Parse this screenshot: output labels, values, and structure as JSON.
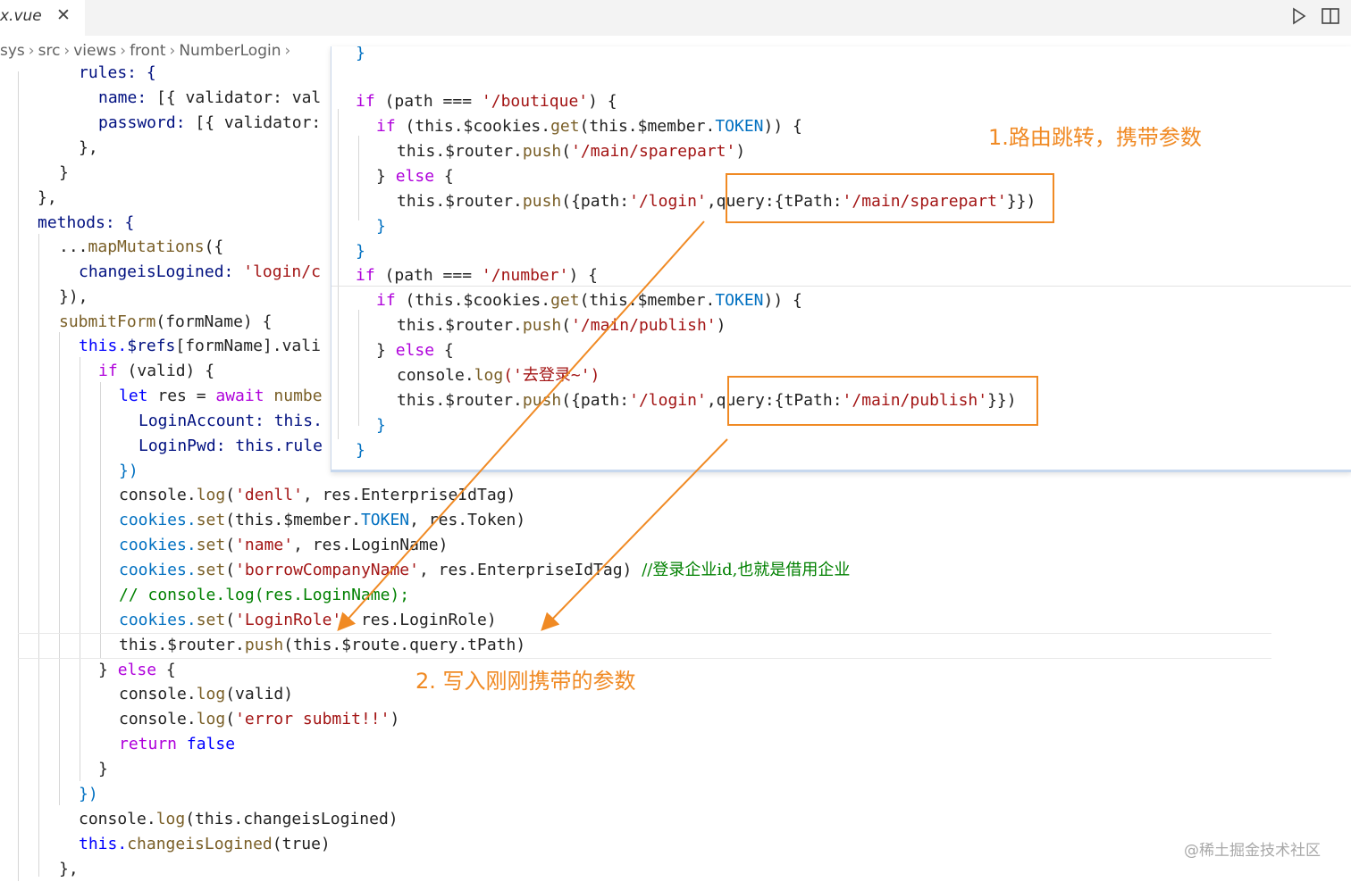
{
  "tab": {
    "filename": "x.vue",
    "close_glyph": "✕"
  },
  "toolbar": {
    "run_icon": "play-icon",
    "split_icon": "split-editor-icon"
  },
  "breadcrumb": [
    "sys",
    "src",
    "views",
    "front",
    "NumberLogin"
  ],
  "editor": {
    "rules_open": "rules: {",
    "name_key": "name:",
    "name_val": " [{ validator: val",
    "password_key": "password:",
    "password_val": " [{ validator:",
    "close_1": "},",
    "close_2": "}",
    "close_3": "},",
    "methods": "methods: {",
    "map_spread": "...",
    "map_fn": "mapMutations",
    "map_paren": "({",
    "changeis_key": "changeisLogined:",
    "changeis_val": " 'login/c",
    "map_close": "}),",
    "submit_fn": "submitForm",
    "submit_rest": "(formName) {",
    "this_refs": "this.",
    "refs_prop": "$refs",
    "refs_rest": "[formName].vali",
    "if_kw": "if",
    "if_rest": " (valid) {",
    "let_kw": "let",
    "res_mid": " res = ",
    "await_kw": "await",
    "numbe": " numbe",
    "login_acc": "LoginAccount: this.",
    "login_pwd": "LoginPwd: this.rule",
    "close_paren": "})",
    "log1_a": "console.",
    "log1_fn": "log",
    "log1_str": "'denll'",
    "log1_rest": ", res.EnterpriseIdTag)",
    "set1_a": "cookies.",
    "set_fn": "set",
    "set1_b": "(this.$member.",
    "set1_token": "TOKEN",
    "set1_rest": ", res.Token)",
    "set2_str": "'name'",
    "set2_rest": ", res.LoginName)",
    "set3_str": "'borrowCompanyName'",
    "set3_rest": ", res.EnterpriseIdTag) ",
    "set3_comment": "//登录企业id,也就是借用企业",
    "comment_line": "// console.log(res.LoginName);",
    "set4_str": "'LoginRole'",
    "set4_rest": ", res.LoginRole)",
    "push_line_a": "this.$router.",
    "push_fn": "push",
    "push_line_b": "(this.$route.query.tPath)",
    "else_close": "} ",
    "else_kw": "else",
    "else_open": " {",
    "log_valid": "(valid)",
    "log_err_str": "'error submit!!'",
    "return_kw": "return",
    "false_kw": " false",
    "brace_close": "}",
    "paren_close": "})",
    "log_changeis": "(this.changeisLogined)",
    "changeis_call_a": "this.",
    "changeis_call_fn": "changeisLogined",
    "changeis_call_b": "(true)",
    "final_close": "},"
  },
  "peek": {
    "top_brace": "}",
    "if_kw": "if",
    "cond1": " (path === ",
    "path1": "'/boutique'",
    "cond_end": ") {",
    "if_inner": "if",
    "cookie_a": " (this.$cookies.",
    "get_fn": "get",
    "cookie_b": "(this.$member.",
    "token": "TOKEN",
    "cookie_c": ")) {",
    "router_a": "this.$router.",
    "push_fn": "push",
    "route1": "'/main/sparepart'",
    "rparen": ")",
    "else_a": "} ",
    "else_kw": "else",
    "else_b": " {",
    "push_obj_a": "({path:",
    "login_str": "'/login'",
    "push_obj_b": ",query:{tPath:",
    "push_obj_c": "}})",
    "close1": "}",
    "close2": "}",
    "path2": "'/number'",
    "route2": "'/main/publish'",
    "console_a": "console.",
    "log_fn": "log",
    "console_str": "('去登录~')",
    "close3": "}",
    "close4": "}"
  },
  "annotations": {
    "step1": "1.路由跳转，携带参数",
    "step2": "2. 写入刚刚携带的参数",
    "accent": "#f08a24"
  },
  "watermark": "@稀土掘金技术社区"
}
